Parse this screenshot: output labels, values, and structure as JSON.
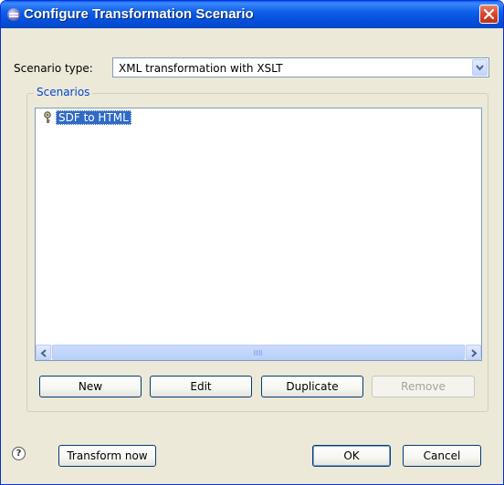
{
  "window": {
    "title": "Configure Transformation Scenario"
  },
  "scenario_type": {
    "label": "Scenario type:",
    "value": "XML transformation with XSLT"
  },
  "scenarios": {
    "group_label": "Scenarios",
    "items": [
      {
        "label": "SDF to HTML",
        "icon": "key-icon",
        "selected": true
      }
    ],
    "scrollbar_grip": "III"
  },
  "actions": {
    "new": "New",
    "edit": "Edit",
    "duplicate": "Duplicate",
    "remove": "Remove"
  },
  "footer": {
    "help_glyph": "?",
    "transform_now": "Transform now",
    "ok": "OK",
    "cancel": "Cancel"
  },
  "colors": {
    "titlebar": "#0a5bf4",
    "selection": "#316ac5",
    "group_title": "#0046d5",
    "dialog_bg": "#ece9d8",
    "close_button": "#d5462a"
  }
}
